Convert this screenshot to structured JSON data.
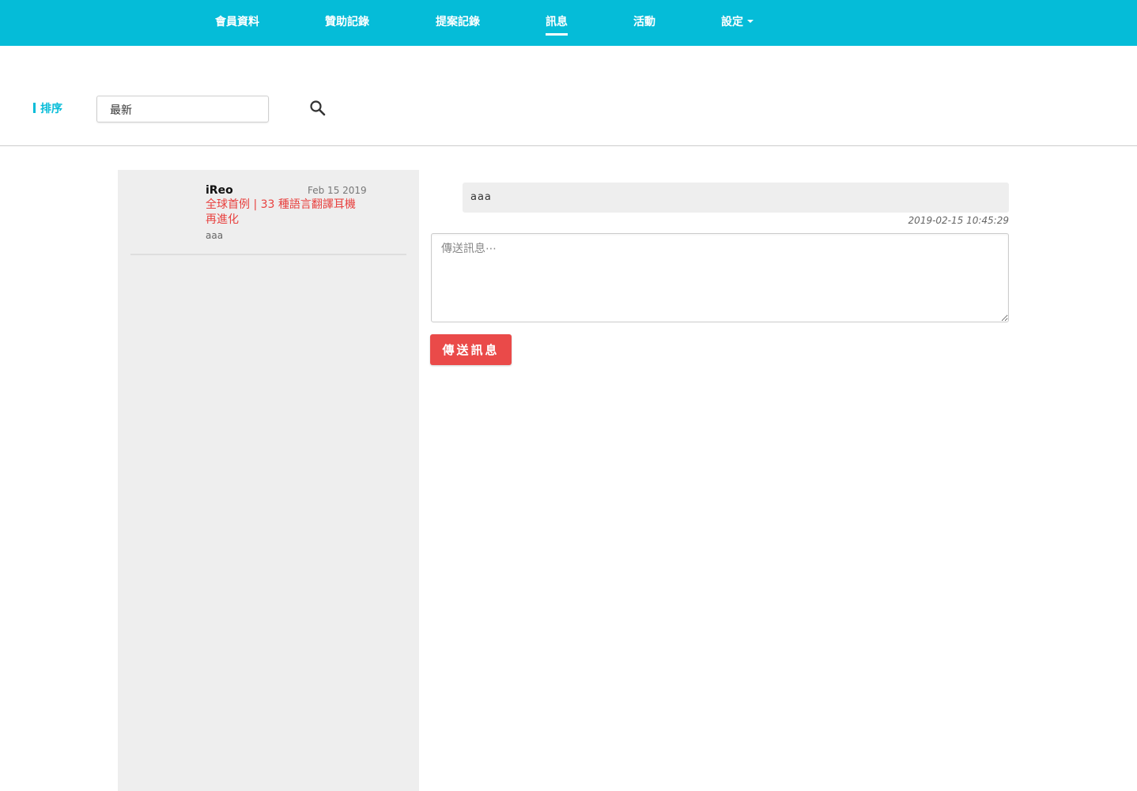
{
  "nav": {
    "items": [
      {
        "label": "會員資料",
        "active": false
      },
      {
        "label": "贊助記錄",
        "active": false
      },
      {
        "label": "提案記錄",
        "active": false
      },
      {
        "label": "訊息",
        "active": true
      },
      {
        "label": "活動",
        "active": false
      },
      {
        "label": "設定",
        "active": false,
        "has_dropdown": true
      }
    ]
  },
  "sort": {
    "label": "排序",
    "selected": "最新"
  },
  "conversations": [
    {
      "name": "iReo",
      "date": "Feb 15 2019",
      "project": "全球首例 | 33 種語言翻譯耳機再進化",
      "preview": "aaa"
    }
  ],
  "thread": {
    "messages": [
      {
        "text": "aaa",
        "time": "2019-02-15 10:45:29"
      }
    ],
    "input_placeholder": "傳送訊息⋯",
    "send_label": "傳送訊息"
  },
  "colors": {
    "primary": "#05bcd8",
    "accent": "#e8413f",
    "send_button": "#ea4a49",
    "panel": "#eeeeee"
  },
  "icons": {
    "search": "search-icon",
    "dropdown": "caret-down-icon"
  }
}
